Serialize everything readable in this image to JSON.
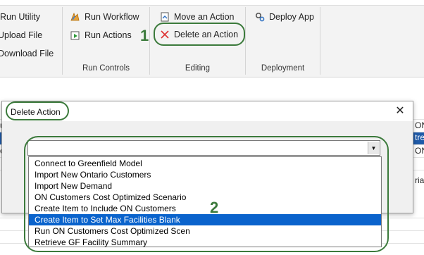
{
  "ribbon": {
    "groups": {
      "utility": {
        "buttons": [
          "Run Utility",
          "Upload File",
          "Download File"
        ]
      },
      "run_controls": {
        "label": "Run Controls",
        "buttons": [
          "Run Workflow",
          "Run Actions"
        ]
      },
      "editing": {
        "label": "Editing",
        "buttons": [
          "Move an Action",
          "Delete an Action"
        ]
      },
      "deployment": {
        "label": "Deployment",
        "buttons": [
          "Deploy App"
        ]
      }
    }
  },
  "sheet": {
    "right_cells": [
      "ON",
      "tre",
      "ON",
      "ria"
    ],
    "left_cells": [
      "us",
      "e"
    ]
  },
  "dialog": {
    "title": "Delete Action",
    "close_glyph": "✕",
    "combo_value": "",
    "combo_arrow": "▼",
    "items": [
      "Connect to Greenfield Model",
      "Import New Ontario Customers",
      "Import New Demand",
      "ON Customers Cost Optimized Scenario",
      "Create Item to Include ON Customers",
      "Create Item to Set Max Facilities Blank",
      "Run ON Customers Cost Optimized Scen",
      "Retrieve GF Facility Summary"
    ],
    "selected_index": 5
  },
  "annotations": {
    "step1": "1",
    "step2": "2",
    "color": "#3b7a3b"
  },
  "colors": {
    "selection": "#0a63cc",
    "sheet_selection": "#1e5aa8"
  }
}
